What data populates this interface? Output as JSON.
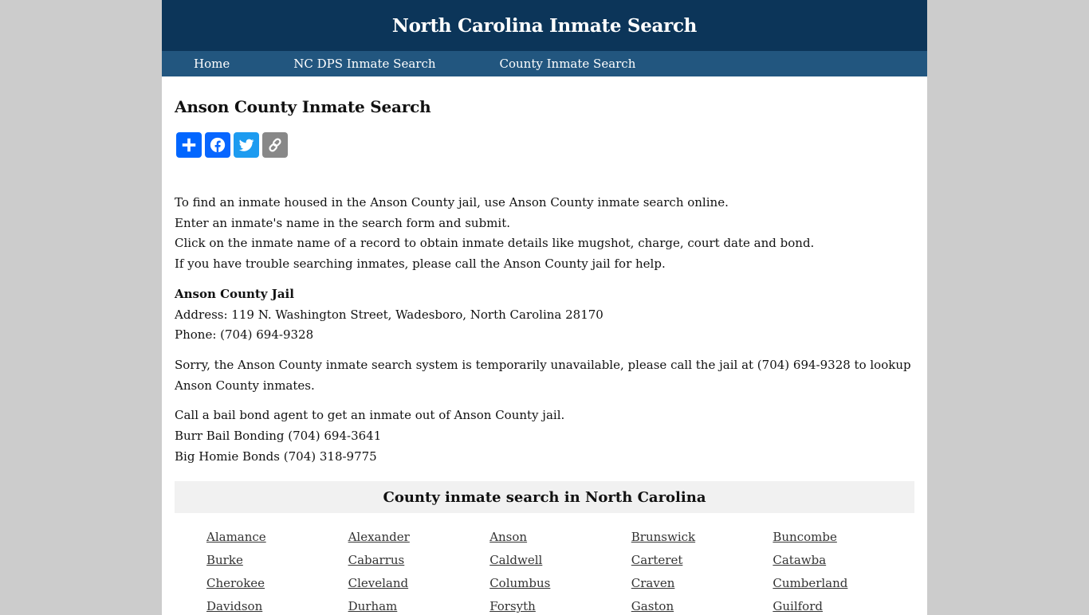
{
  "header": {
    "title": "North Carolina Inmate Search"
  },
  "nav": {
    "items": [
      {
        "label": "Home"
      },
      {
        "label": "NC DPS Inmate Search"
      },
      {
        "label": "County Inmate Search"
      }
    ]
  },
  "main": {
    "heading": "Anson County Inmate Search",
    "share_buttons": [
      {
        "name": "share",
        "icon": "plus-icon",
        "color": "#0166ff"
      },
      {
        "name": "facebook",
        "icon": "facebook-icon",
        "color": "#0866ff"
      },
      {
        "name": "twitter",
        "icon": "twitter-icon",
        "color": "#1d9bf0"
      },
      {
        "name": "copy-link",
        "icon": "link-icon",
        "color": "#888888"
      }
    ],
    "intro_lines": [
      "To find an inmate housed in the Anson County jail, use Anson County inmate search online.",
      "Enter an inmate's name in the search form and submit.",
      "Click on the inmate name of a record to obtain inmate details like mugshot, charge, court date and bond.",
      "If you have trouble searching inmates, please call the Anson County jail for help."
    ],
    "jail": {
      "name": "Anson County Jail",
      "address": "Address: 119 N. Washington Street, Wadesboro, North Carolina 28170",
      "phone": "Phone: (704) 694-9328"
    },
    "notice": "Sorry, the Anson County inmate search system is temporarily unavailable, please call the jail at (704) 694-9328 to lookup Anson County inmates.",
    "bail": {
      "intro": "Call a bail bond agent to get an inmate out of Anson County jail.",
      "agents": [
        "Burr Bail Bonding (704) 694-3641",
        "Big Homie Bonds (704) 318-9775"
      ]
    },
    "county_section": {
      "title": "County inmate search in North Carolina",
      "counties": [
        "Alamance",
        "Alexander",
        "Anson",
        "Brunswick",
        "Buncombe",
        "Burke",
        "Cabarrus",
        "Caldwell",
        "Carteret",
        "Catawba",
        "Cherokee",
        "Cleveland",
        "Columbus",
        "Craven",
        "Cumberland",
        "Davidson",
        "Durham",
        "Forsyth",
        "Gaston",
        "Guilford"
      ]
    }
  },
  "colors": {
    "header_bg": "#0c3559",
    "nav_bg": "#22567f",
    "page_bg": "#cccccc",
    "county_box_bg": "#f1f1f1",
    "link": "#333333"
  }
}
